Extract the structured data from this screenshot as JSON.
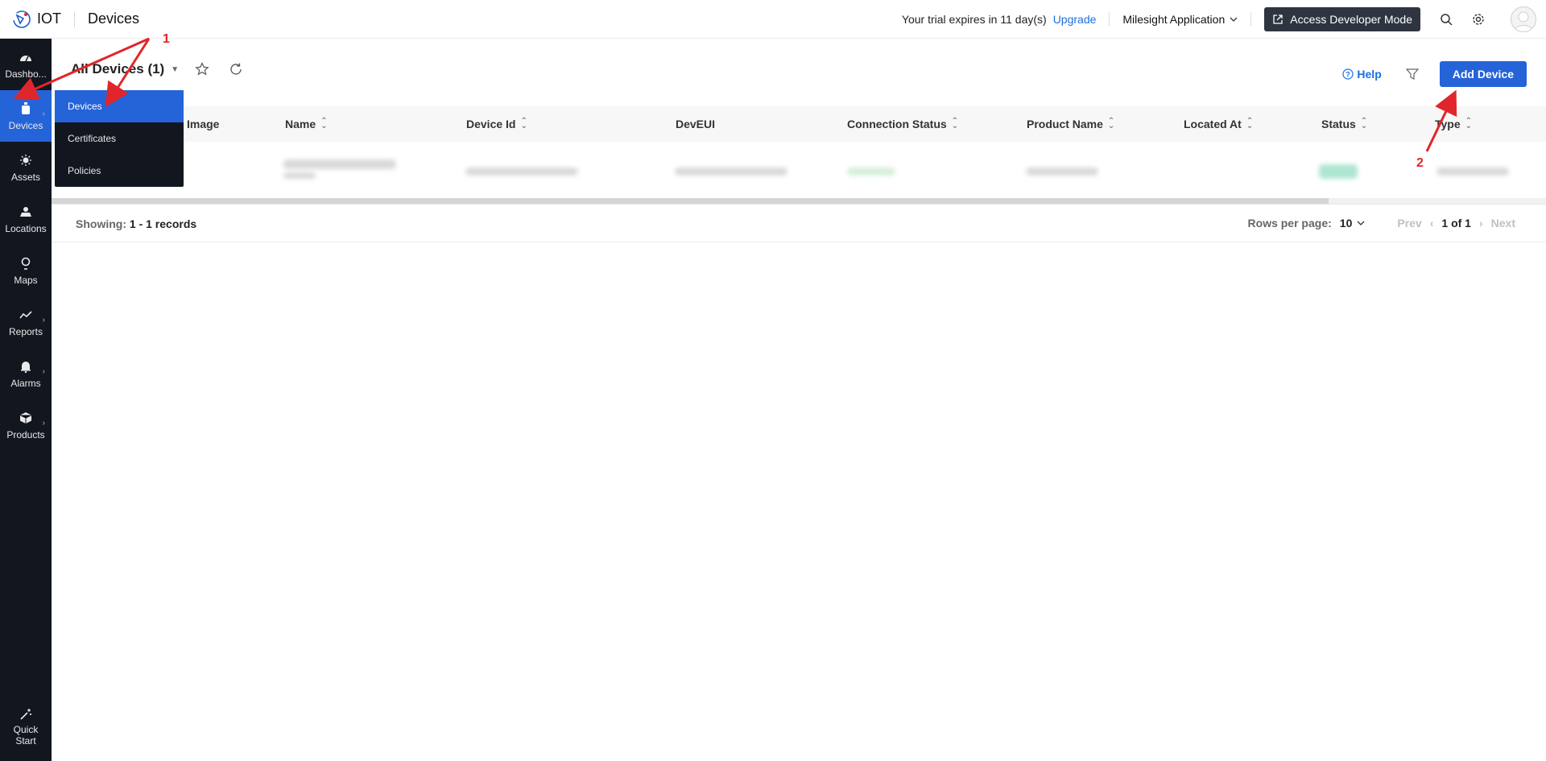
{
  "header": {
    "brand": "IOT",
    "page_title": "Devices",
    "trial_text": "Your trial expires in 11 day(s)",
    "upgrade_label": "Upgrade",
    "app_name": "Milesight Application",
    "developer_mode_label": "Access Developer Mode"
  },
  "sidebar": {
    "items": [
      {
        "label": "Dashbo...",
        "icon": "dashboard-icon"
      },
      {
        "label": "Devices",
        "icon": "device-icon",
        "active": true
      },
      {
        "label": "Assets",
        "icon": "bulb-icon"
      },
      {
        "label": "Locations",
        "icon": "location-icon"
      },
      {
        "label": "Maps",
        "icon": "map-pin-icon"
      },
      {
        "label": "Reports",
        "icon": "trend-icon"
      },
      {
        "label": "Alarms",
        "icon": "bell-icon"
      },
      {
        "label": "Products",
        "icon": "box-icon"
      }
    ],
    "quick_start": "Quick Start"
  },
  "submenu": {
    "items": [
      "Devices",
      "Certificates",
      "Policies"
    ]
  },
  "toolbar": {
    "view_title": "All Devices (1)",
    "help_label": "Help",
    "add_device_label": "Add Device"
  },
  "table": {
    "columns": [
      "Image",
      "Name",
      "Device Id",
      "DevEUI",
      "Connection Status",
      "Product Name",
      "Located At",
      "Status",
      "Type"
    ]
  },
  "footer": {
    "showing_label": "Showing:",
    "showing_value": "1 - 1 records",
    "rows_per_page_label": "Rows per page:",
    "rows_per_page_value": "10",
    "prev_label": "Prev",
    "page_count": "1 of 1",
    "next_label": "Next"
  },
  "annotations": [
    "1",
    "2"
  ],
  "colors": {
    "accent": "#2563d9",
    "sidebar_bg": "#12161f",
    "annotation": "#e0262a"
  }
}
